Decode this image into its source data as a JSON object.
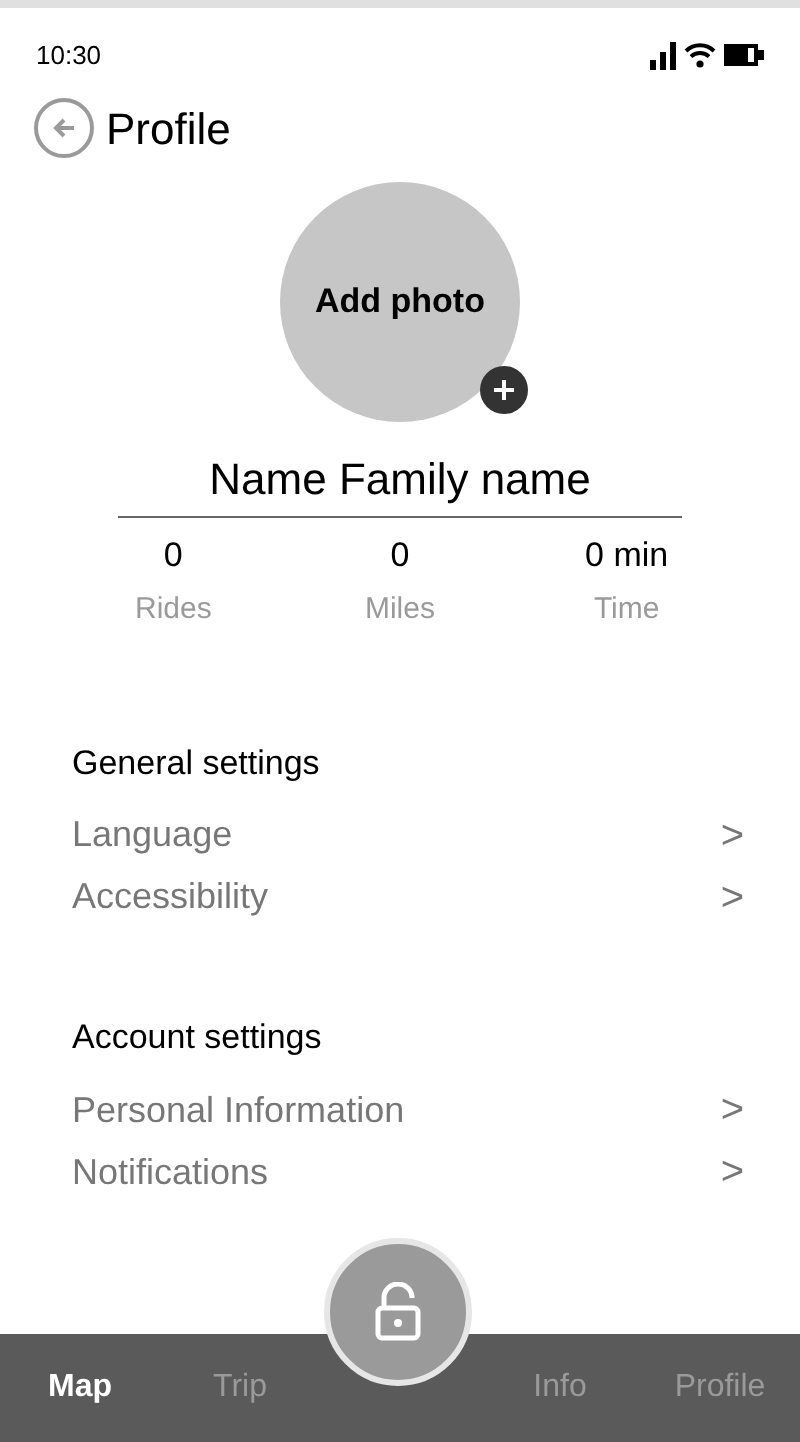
{
  "status_bar": {
    "time": "10:30"
  },
  "header": {
    "title": "Profile"
  },
  "photo": {
    "label": "Add photo"
  },
  "user": {
    "name": "Name Family name"
  },
  "stats": [
    {
      "value": "0",
      "label": "Rides"
    },
    {
      "value": "0",
      "label": "Miles"
    },
    {
      "value": "0 min",
      "label": "Time"
    }
  ],
  "sections": [
    {
      "title": "General settings",
      "items": [
        {
          "label": "Language",
          "chevron": ">"
        },
        {
          "label": "Accessibility",
          "chevron": ">"
        }
      ]
    },
    {
      "title": "Account settings",
      "items": [
        {
          "label": "Personal Information",
          "chevron": ">"
        },
        {
          "label": "Notifications",
          "chevron": ">"
        }
      ]
    }
  ],
  "tab_bar": [
    {
      "label": "Map",
      "selected": true
    },
    {
      "label": "Trip",
      "selected": false
    },
    {
      "label": "Info",
      "selected": false
    },
    {
      "label": "Profile",
      "selected": false
    }
  ]
}
